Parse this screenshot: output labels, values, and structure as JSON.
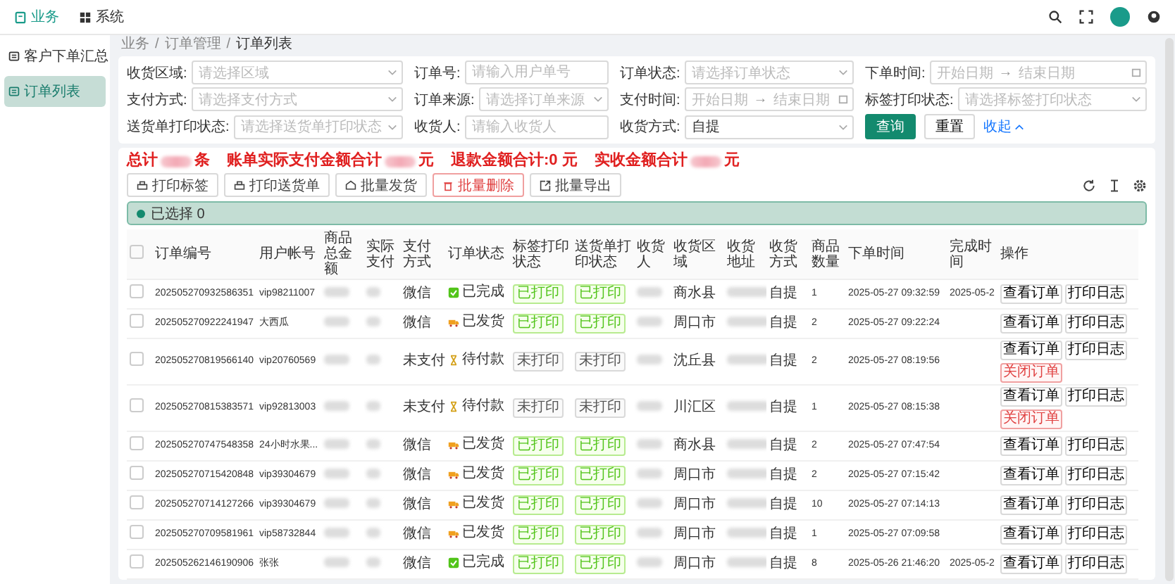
{
  "topnav": {
    "tabs": [
      {
        "label": "业务",
        "selected": true,
        "kind": "business"
      },
      {
        "label": "系统",
        "selected": false,
        "kind": "system"
      }
    ]
  },
  "sidebar": {
    "items": [
      {
        "label": "客户下单汇总",
        "selected": false
      },
      {
        "label": "订单列表",
        "selected": true
      }
    ]
  },
  "breadcrumb": {
    "separator": "/",
    "items": [
      "业务",
      "订单管理",
      "订单列表"
    ]
  },
  "filters": [
    {
      "label": "收货区域:",
      "kind": "select",
      "placeholder": "请选择区域"
    },
    {
      "label": "订单号:",
      "kind": "input",
      "placeholder": "请输入用户单号"
    },
    {
      "label": "订单状态:",
      "kind": "select",
      "placeholder": "请选择订单状态"
    },
    {
      "label": "下单时间:",
      "kind": "daterange",
      "start": "开始日期",
      "separator": "→",
      "end": "结束日期"
    },
    {
      "label": "支付方式:",
      "kind": "select",
      "placeholder": "请选择支付方式"
    },
    {
      "label": "订单来源:",
      "kind": "select",
      "placeholder": "请选择订单来源"
    },
    {
      "label": "支付时间:",
      "kind": "daterange",
      "start": "开始日期",
      "separator": "→",
      "end": "结束日期"
    },
    {
      "label": "标签打印状态:",
      "kind": "select",
      "placeholder": "请选择标签打印状态"
    },
    {
      "label": "送货单打印状态:",
      "kind": "select",
      "placeholder": "请选择送货单打印状态"
    },
    {
      "label": "收货人:",
      "kind": "input",
      "placeholder": "请输入收货人"
    },
    {
      "label": "收货方式:",
      "kind": "select",
      "value": "自提"
    }
  ],
  "filter_actions": {
    "search": "查询",
    "reset": "重置",
    "collapse": "收起"
  },
  "summary": [
    {
      "label": "总计",
      "blurred": true,
      "unit": "条"
    },
    {
      "label": "账单实际支付金额合计",
      "blurred": true,
      "unit": "元"
    },
    {
      "label": "退款金额合计:",
      "value": "0",
      "unit": "元"
    },
    {
      "label": "实收金额合计",
      "blurred": true,
      "unit": "元"
    }
  ],
  "toolbar": [
    {
      "label": "打印标签",
      "kind": "print"
    },
    {
      "label": "打印送货单",
      "kind": "print"
    },
    {
      "label": "批量发货",
      "kind": "ship"
    },
    {
      "label": "批量删除",
      "kind": "delete"
    },
    {
      "label": "批量导出",
      "kind": "export"
    }
  ],
  "selection": {
    "label": "已选择",
    "count": "0"
  },
  "table": {
    "all_checked": false,
    "columns": [
      "订单编号",
      "用户帐号",
      "商品总金额",
      "实际支付",
      "支付方式",
      "订单状态",
      "标签打印状态",
      "送货单打印状态",
      "收货人",
      "收货区域",
      "收货地址",
      "收货方式",
      "商品数量",
      "下单时间",
      "完成时间",
      "操作"
    ],
    "rows": [
      {
        "checked": false,
        "order_no": "202505270932586351",
        "account": "vip98211007",
        "blurred": true,
        "pay": "微信",
        "status": {
          "label": "已完成",
          "kind": "done"
        },
        "label_print": {
          "label": "已打印",
          "printed": true
        },
        "slip_print": {
          "label": "已打印",
          "printed": true
        },
        "region": "商水县",
        "method": "自提",
        "qty": "1",
        "ordered": "2025-05-27 09:32:59",
        "finished": "2025-05-2",
        "actions": [
          {
            "label": "查看订单",
            "kind": "default"
          },
          {
            "label": "打印日志",
            "kind": "default"
          }
        ]
      },
      {
        "checked": false,
        "order_no": "202505270922241947",
        "account": "大西瓜",
        "blurred": true,
        "pay": "微信",
        "status": {
          "label": "已发货",
          "kind": "shipped"
        },
        "label_print": {
          "label": "已打印",
          "printed": true
        },
        "slip_print": {
          "label": "已打印",
          "printed": true
        },
        "region": "周口市",
        "method": "自提",
        "qty": "2",
        "ordered": "2025-05-27 09:22:24",
        "actions": [
          {
            "label": "查看订单",
            "kind": "default"
          },
          {
            "label": "打印日志",
            "kind": "default"
          }
        ]
      },
      {
        "checked": false,
        "order_no": "202505270819566140",
        "account": "vip20760569",
        "blurred": true,
        "pay": "未支付",
        "status": {
          "label": "待付款",
          "kind": "pending"
        },
        "label_print": {
          "label": "未打印",
          "printed": false
        },
        "slip_print": {
          "label": "未打印",
          "printed": false
        },
        "region": "沈丘县",
        "method": "自提",
        "qty": "2",
        "ordered": "2025-05-27 08:19:56",
        "actions": [
          {
            "label": "查看订单",
            "kind": "default"
          },
          {
            "label": "打印日志",
            "kind": "default"
          },
          {
            "label": "关闭订单",
            "kind": "danger"
          }
        ]
      },
      {
        "checked": false,
        "order_no": "202505270815383571",
        "account": "vip92813003",
        "blurred": true,
        "pay": "未支付",
        "status": {
          "label": "待付款",
          "kind": "pending"
        },
        "label_print": {
          "label": "未打印",
          "printed": false
        },
        "slip_print": {
          "label": "未打印",
          "printed": false
        },
        "region": "川汇区",
        "method": "自提",
        "qty": "1",
        "ordered": "2025-05-27 08:15:38",
        "actions": [
          {
            "label": "查看订单",
            "kind": "default"
          },
          {
            "label": "打印日志",
            "kind": "default"
          },
          {
            "label": "关闭订单",
            "kind": "danger"
          }
        ]
      },
      {
        "checked": false,
        "order_no": "202505270747548358",
        "account": "24小时水果...",
        "blurred": true,
        "pay": "微信",
        "status": {
          "label": "已发货",
          "kind": "shipped"
        },
        "label_print": {
          "label": "已打印",
          "printed": true
        },
        "slip_print": {
          "label": "已打印",
          "printed": true
        },
        "region": "商水县",
        "method": "自提",
        "qty": "2",
        "ordered": "2025-05-27 07:47:54",
        "actions": [
          {
            "label": "查看订单",
            "kind": "default"
          },
          {
            "label": "打印日志",
            "kind": "default"
          }
        ]
      },
      {
        "checked": false,
        "order_no": "202505270715420848",
        "account": "vip39304679",
        "blurred": true,
        "pay": "微信",
        "status": {
          "label": "已发货",
          "kind": "shipped"
        },
        "label_print": {
          "label": "已打印",
          "printed": true
        },
        "slip_print": {
          "label": "已打印",
          "printed": true
        },
        "region": "周口市",
        "method": "自提",
        "qty": "2",
        "ordered": "2025-05-27 07:15:42",
        "actions": [
          {
            "label": "查看订单",
            "kind": "default"
          },
          {
            "label": "打印日志",
            "kind": "default"
          }
        ]
      },
      {
        "checked": false,
        "order_no": "202505270714127266",
        "account": "vip39304679",
        "blurred": true,
        "pay": "微信",
        "status": {
          "label": "已发货",
          "kind": "shipped"
        },
        "label_print": {
          "label": "已打印",
          "printed": true
        },
        "slip_print": {
          "label": "已打印",
          "printed": true
        },
        "region": "周口市",
        "method": "自提",
        "qty": "10",
        "ordered": "2025-05-27 07:14:13",
        "actions": [
          {
            "label": "查看订单",
            "kind": "default"
          },
          {
            "label": "打印日志",
            "kind": "default"
          }
        ]
      },
      {
        "checked": false,
        "order_no": "202505270709581961",
        "account": "vip58732844",
        "blurred": true,
        "pay": "微信",
        "status": {
          "label": "已发货",
          "kind": "shipped"
        },
        "label_print": {
          "label": "已打印",
          "printed": true
        },
        "slip_print": {
          "label": "已打印",
          "printed": true
        },
        "region": "周口市",
        "method": "自提",
        "qty": "1",
        "ordered": "2025-05-27 07:09:58",
        "actions": [
          {
            "label": "查看订单",
            "kind": "default"
          },
          {
            "label": "打印日志",
            "kind": "default"
          }
        ]
      },
      {
        "checked": false,
        "order_no": "202505262146190906",
        "account": "张张",
        "blurred": true,
        "pay": "微信",
        "status": {
          "label": "已完成",
          "kind": "done"
        },
        "label_print": {
          "label": "已打印",
          "printed": true
        },
        "slip_print": {
          "label": "已打印",
          "printed": true
        },
        "region": "周口市",
        "method": "自提",
        "qty": "8",
        "ordered": "2025-05-26 21:46:20",
        "finished": "2025-05-2",
        "actions": [
          {
            "label": "查看订单",
            "kind": "default"
          },
          {
            "label": "打印日志",
            "kind": "default"
          }
        ]
      }
    ]
  }
}
